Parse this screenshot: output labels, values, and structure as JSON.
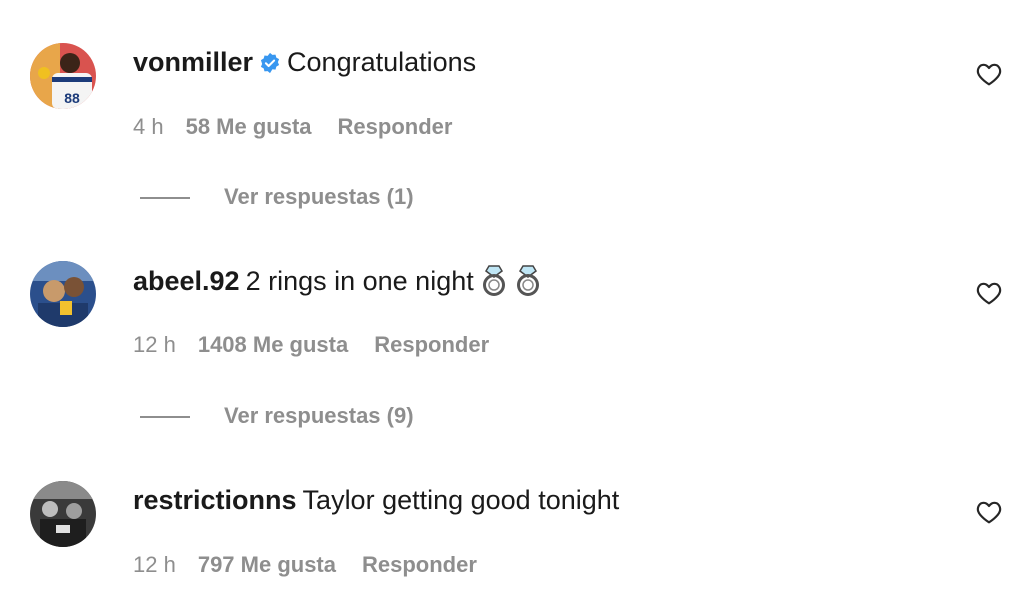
{
  "comments": [
    {
      "username": "vonmiller",
      "verified": true,
      "text": "Congratulations",
      "emoji": [],
      "time": "4 h",
      "likes": "58 Me gusta",
      "reply_label": "Responder",
      "view_replies": "Ver respuestas (1)"
    },
    {
      "username": "abeel.92",
      "verified": false,
      "text": "2 rings in one night",
      "emoji": [
        "ring-emoji",
        "ring-emoji"
      ],
      "time": "12 h",
      "likes": "1408 Me gusta",
      "reply_label": "Responder",
      "view_replies": "Ver respuestas (9)"
    },
    {
      "username": "restrictionns",
      "verified": false,
      "text": "Taylor getting good tonight",
      "emoji": [],
      "time": "12 h",
      "likes": "797 Me gusta",
      "reply_label": "Responder"
    }
  ],
  "colors": {
    "primary_text": "#1a1a1a",
    "secondary_text": "#8e8e8e",
    "verified_badge": "#3897f0"
  },
  "icons": {
    "like": "heart-outline-icon",
    "verified": "verified-badge-icon"
  }
}
